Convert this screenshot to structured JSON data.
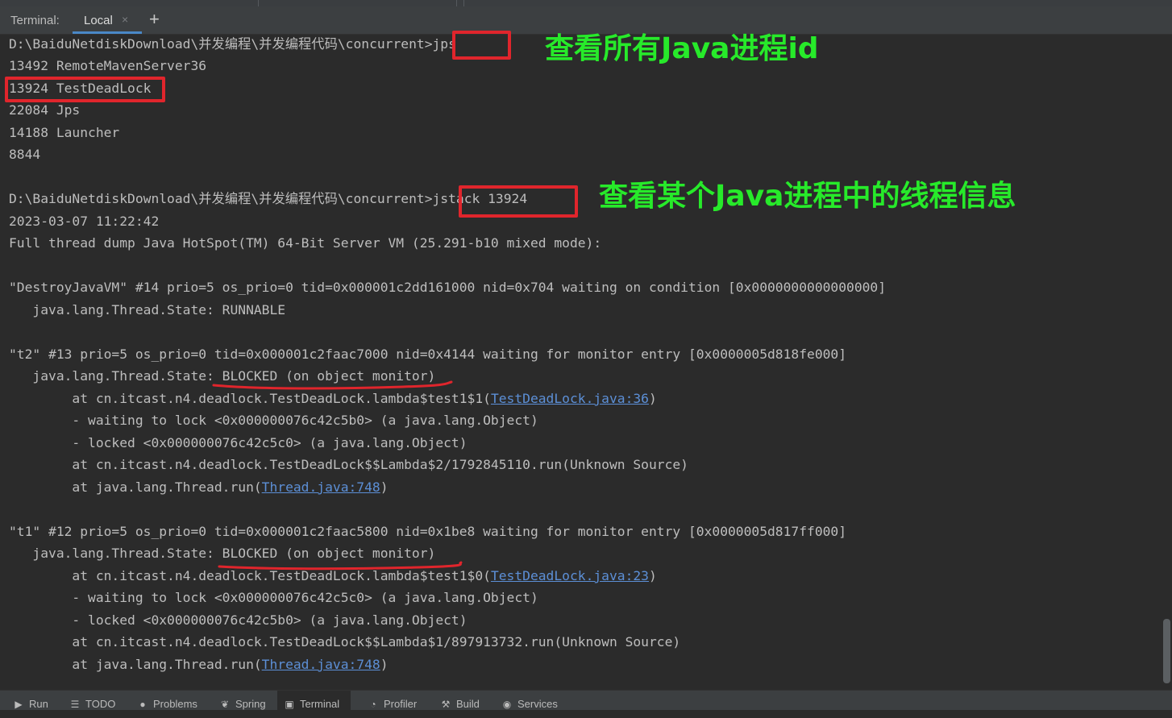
{
  "tool_window": {
    "title_label": "Terminal:",
    "tab_label": "Local",
    "tab_close": "×",
    "new_tab": "+"
  },
  "terminal": {
    "lines": [
      {
        "text": "D:\\BaiduNetdiskDownload\\并发编程\\并发编程代码\\concurrent>jps"
      },
      {
        "text": "13492 RemoteMavenServer36"
      },
      {
        "text": "13924 TestDeadLock"
      },
      {
        "text": "22084 Jps"
      },
      {
        "text": "14188 Launcher"
      },
      {
        "text": "8844"
      },
      {
        "text": ""
      },
      {
        "text": "D:\\BaiduNetdiskDownload\\并发编程\\并发编程代码\\concurrent>jstack 13924"
      },
      {
        "text": "2023-03-07 11:22:42"
      },
      {
        "text": "Full thread dump Java HotSpot(TM) 64-Bit Server VM (25.291-b10 mixed mode):"
      },
      {
        "text": ""
      },
      {
        "text": "\"DestroyJavaVM\" #14 prio=5 os_prio=0 tid=0x000001c2dd161000 nid=0x704 waiting on condition [0x0000000000000000]"
      },
      {
        "text": "   java.lang.Thread.State: RUNNABLE"
      },
      {
        "text": ""
      },
      {
        "text": "\"t2\" #13 prio=5 os_prio=0 tid=0x000001c2faac7000 nid=0x4144 waiting for monitor entry [0x0000005d818fe000]"
      },
      {
        "text": "   java.lang.Thread.State: BLOCKED (on object monitor)"
      },
      {
        "pre": "        at cn.itcast.n4.deadlock.TestDeadLock.lambda$test1$1(",
        "link": "TestDeadLock.java:36",
        "post": ")"
      },
      {
        "text": "        - waiting to lock <0x000000076c42c5b0> (a java.lang.Object)"
      },
      {
        "text": "        - locked <0x000000076c42c5c0> (a java.lang.Object)"
      },
      {
        "text": "        at cn.itcast.n4.deadlock.TestDeadLock$$Lambda$2/1792845110.run(Unknown Source)"
      },
      {
        "pre": "        at java.lang.Thread.run(",
        "link": "Thread.java:748",
        "post": ")"
      },
      {
        "text": ""
      },
      {
        "text": "\"t1\" #12 prio=5 os_prio=0 tid=0x000001c2faac5800 nid=0x1be8 waiting for monitor entry [0x0000005d817ff000]"
      },
      {
        "text": "   java.lang.Thread.State: BLOCKED (on object monitor)"
      },
      {
        "pre": "        at cn.itcast.n4.deadlock.TestDeadLock.lambda$test1$0(",
        "link": "TestDeadLock.java:23",
        "post": ")"
      },
      {
        "text": "        - waiting to lock <0x000000076c42c5c0> (a java.lang.Object)"
      },
      {
        "text": "        - locked <0x000000076c42c5b0> (a java.lang.Object)"
      },
      {
        "text": "        at cn.itcast.n4.deadlock.TestDeadLock$$Lambda$1/897913732.run(Unknown Source)"
      },
      {
        "pre": "        at java.lang.Thread.run(",
        "link": "Thread.java:748",
        "post": ")"
      }
    ]
  },
  "annotations": {
    "jps_note": "查看所有Java进程id",
    "jstack_note": "查看某个Java进程中的线程信息",
    "highlight_color": "#e0252c",
    "note_color": "#27ea2a"
  },
  "bottom_bar": {
    "items": [
      {
        "label": "Run",
        "icon": "run-icon"
      },
      {
        "label": "TODO",
        "icon": "list-icon"
      },
      {
        "label": "Problems",
        "icon": "problems-icon"
      },
      {
        "label": "Spring",
        "icon": "spring-leaf-icon"
      },
      {
        "label": "Terminal",
        "icon": "terminal-icon",
        "active": true
      },
      {
        "label": "Profiler",
        "icon": "profiler-icon"
      },
      {
        "label": "Build",
        "icon": "hammer-icon"
      },
      {
        "label": "Services",
        "icon": "services-icon"
      }
    ]
  },
  "colors": {
    "background": "#2b2b2b",
    "text": "#bdbdbd",
    "link": "#5c8fd6",
    "tab_underline": "#4a88c7"
  }
}
